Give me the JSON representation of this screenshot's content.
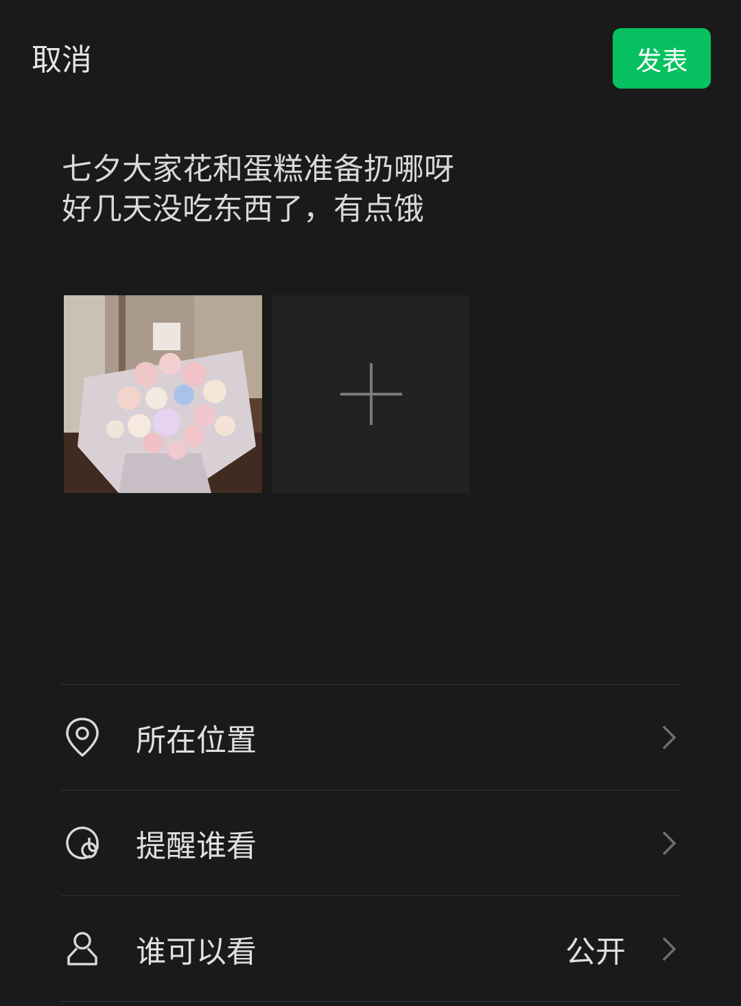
{
  "header": {
    "cancel_label": "取消",
    "publish_label": "发表"
  },
  "post": {
    "lines": [
      "七夕大家花和蛋糕准备扔哪呀",
      "好几天没吃东西了，有点饿"
    ]
  },
  "media": {
    "photo_icon": "flower-bouquet-photo",
    "add_icon": "plus-icon"
  },
  "options": [
    {
      "label": "所在位置",
      "icon": "location-pin-icon",
      "value": ""
    },
    {
      "label": "提醒谁看",
      "icon": "at-sign-icon",
      "value": ""
    },
    {
      "label": "谁可以看",
      "icon": "person-icon",
      "value": "公开"
    }
  ],
  "colors": {
    "background": "#1a1a1a",
    "accent": "#07c160",
    "divider": "#333333"
  }
}
